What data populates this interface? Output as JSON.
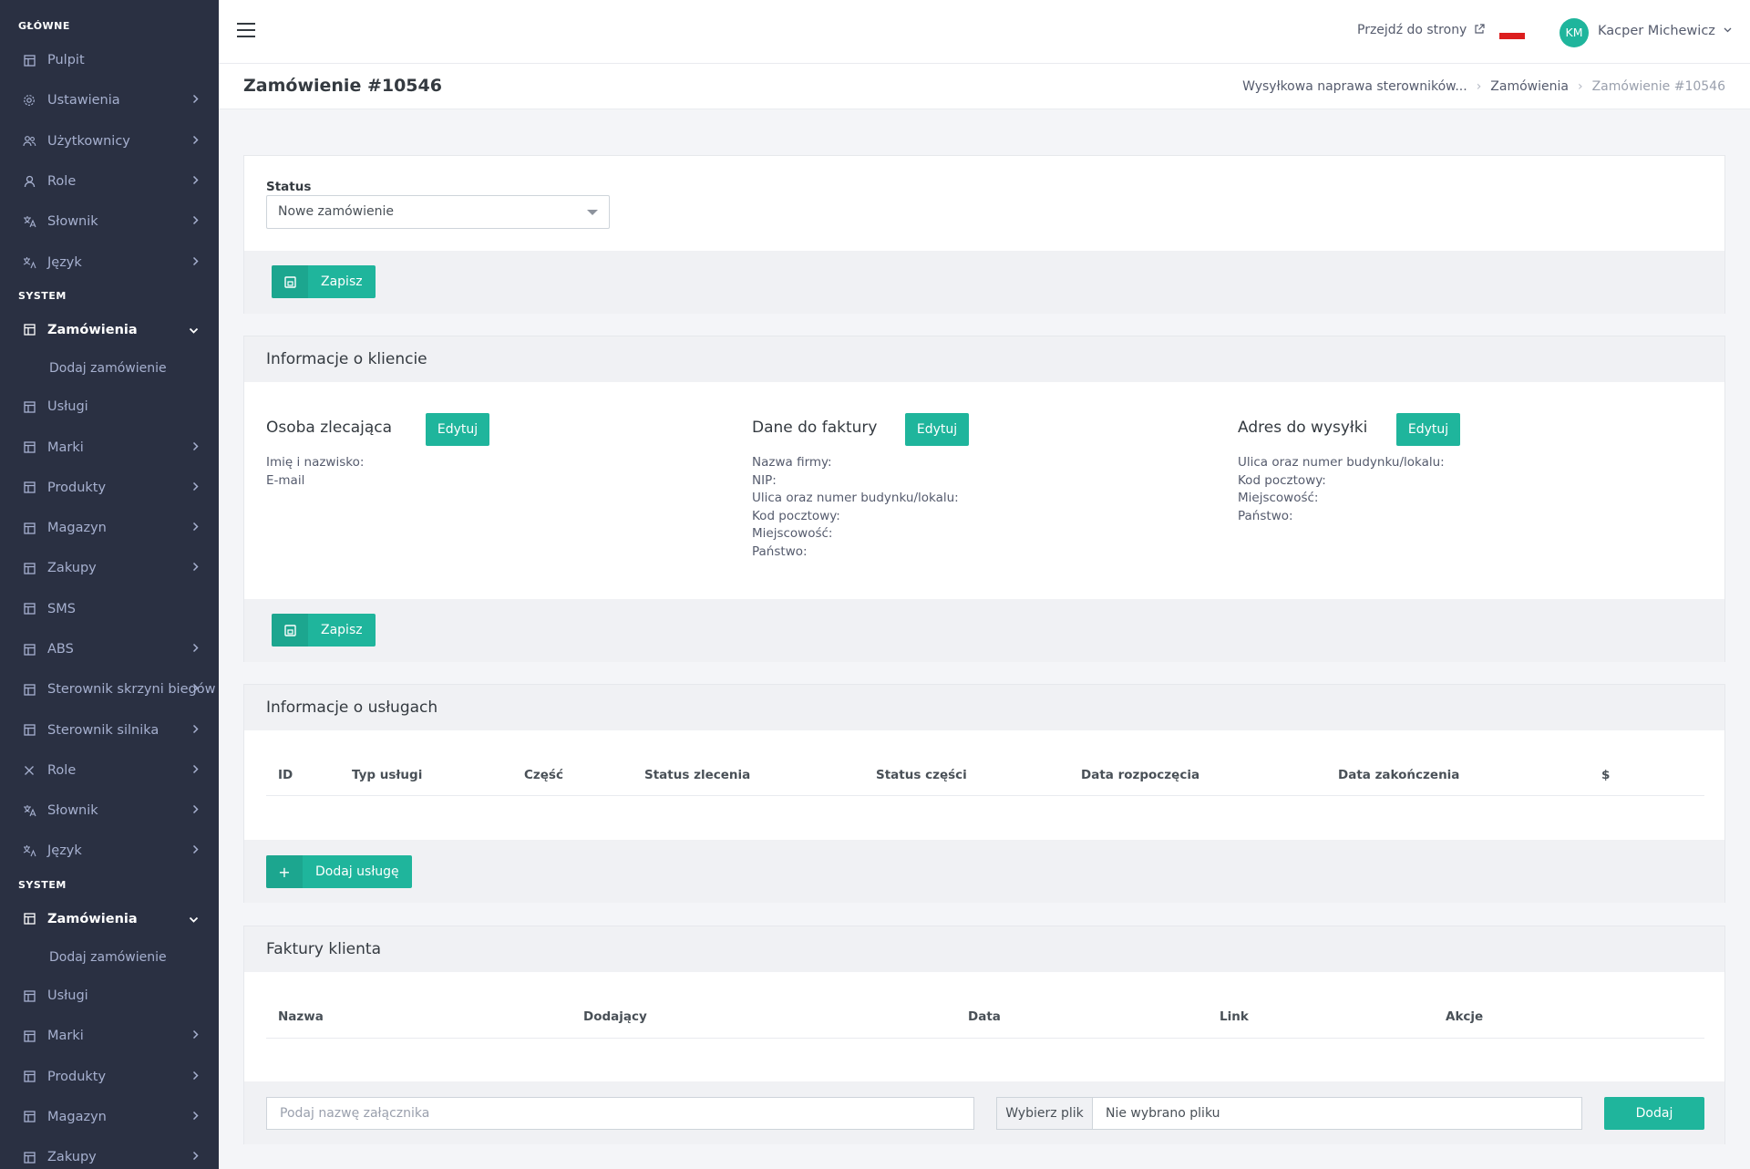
{
  "sidebar": {
    "sections": [
      {
        "title": "GŁÓWNE",
        "items": [
          {
            "label": "Pulpit",
            "icon": "layout-icon",
            "chevron": false
          },
          {
            "label": "Ustawienia",
            "icon": "gear-icon",
            "chevron": true
          },
          {
            "label": "Użytkownicy",
            "icon": "users-icon",
            "chevron": true
          },
          {
            "label": "Role",
            "icon": "user-icon",
            "chevron": true
          },
          {
            "label": "Słownik",
            "icon": "translate-icon",
            "chevron": true
          },
          {
            "label": "Język",
            "icon": "language-icon",
            "chevron": true
          }
        ]
      },
      {
        "title": "SYSTEM",
        "items": [
          {
            "label": "Zamówienia",
            "icon": "layout-icon",
            "active": true,
            "expanded": true,
            "sub": [
              "Dodaj zamówienie"
            ]
          },
          {
            "label": "Usługi",
            "icon": "layout-icon",
            "chevron": false
          },
          {
            "label": "Marki",
            "icon": "layout-icon",
            "chevron": true
          },
          {
            "label": "Produkty",
            "icon": "layout-icon",
            "chevron": true
          },
          {
            "label": "Magazyn",
            "icon": "layout-icon",
            "chevron": true
          },
          {
            "label": "Zakupy",
            "icon": "layout-icon",
            "chevron": true
          },
          {
            "label": "SMS",
            "icon": "layout-icon",
            "chevron": false
          },
          {
            "label": "ABS",
            "icon": "layout-icon",
            "chevron": true
          },
          {
            "label": "Sterownik skrzyni biegów",
            "icon": "layout-icon",
            "chevron": true
          },
          {
            "label": "Sterownik silnika",
            "icon": "layout-icon",
            "chevron": true
          },
          {
            "label": "Role",
            "icon": "close-icon",
            "chevron": true
          },
          {
            "label": "Słownik",
            "icon": "translate-icon",
            "chevron": true
          },
          {
            "label": "Język",
            "icon": "language-icon",
            "chevron": true
          }
        ]
      },
      {
        "title": "SYSTEM",
        "items": [
          {
            "label": "Zamówienia",
            "icon": "layout-icon",
            "active": true,
            "expanded": true,
            "sub": [
              "Dodaj zamówienie"
            ]
          },
          {
            "label": "Usługi",
            "icon": "layout-icon",
            "chevron": false
          },
          {
            "label": "Marki",
            "icon": "layout-icon",
            "chevron": true
          },
          {
            "label": "Produkty",
            "icon": "layout-icon",
            "chevron": true
          },
          {
            "label": "Magazyn",
            "icon": "layout-icon",
            "chevron": true
          },
          {
            "label": "Zakupy",
            "icon": "layout-icon",
            "chevron": true
          }
        ]
      }
    ]
  },
  "header": {
    "goto_label": "Przejdź do strony",
    "user_initials": "KM",
    "user_name": "Kacper Michewicz",
    "accent_color": "#1fb59c"
  },
  "page": {
    "title": "Zamówienie #10546",
    "breadcrumb": [
      "Wysyłkowa naprawa sterowników...",
      "Zamówienia",
      "Zamówienie #10546"
    ]
  },
  "status_card": {
    "label": "Status",
    "selected": "Nowe zamówienie",
    "save_label": "Zapisz"
  },
  "client_card": {
    "title": "Informacje o kliencie",
    "save_label": "Zapisz",
    "columns": [
      {
        "title": "Osoba zlecająca",
        "edit_label": "Edytuj",
        "fields": [
          "Imię i nazwisko:",
          "E-mail"
        ]
      },
      {
        "title": "Dane do faktury",
        "edit_label": "Edytuj",
        "fields": [
          "Nazwa firmy:",
          "NIP:",
          "Ulica oraz numer budynku/lokalu:",
          "Kod pocztowy:",
          "Miejscowość:",
          "Państwo:"
        ]
      },
      {
        "title": "Adres do wysyłki",
        "edit_label": "Edytuj",
        "fields": [
          "Ulica oraz numer budynku/lokalu:",
          "Kod pocztowy:",
          "Miejscowość:",
          "Państwo:"
        ]
      }
    ]
  },
  "services_card": {
    "title": "Informacje o usługach",
    "columns": [
      "ID",
      "Typ usługi",
      "Część",
      "Status zlecenia",
      "Status części",
      "Data rozpoczęcia",
      "Data zakończenia",
      "$"
    ],
    "add_label": "Dodaj usługę"
  },
  "invoices_card": {
    "title": "Faktury klienta",
    "columns": [
      "Nazwa",
      "Dodający",
      "Data",
      "Link",
      "Akcje"
    ],
    "name_placeholder": "Podaj nazwę załącznika",
    "file_button": "Wybierz plik",
    "file_name": "Nie wybrano pliku",
    "add_label": "Dodaj"
  }
}
